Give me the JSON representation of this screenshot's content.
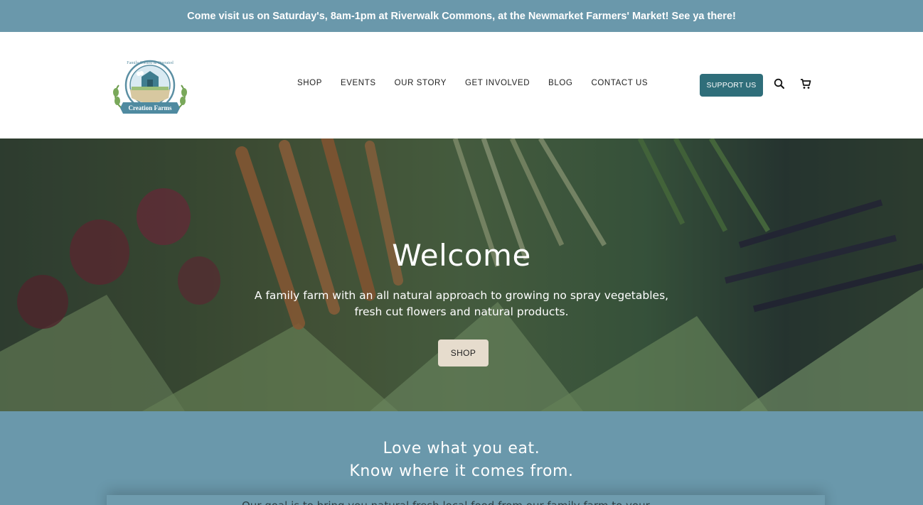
{
  "announcement": {
    "text": "Come visit us on Saturday's, 8am-1pm at Riverwalk Commons, at the Newmarket Farmers' Market! See ya there!"
  },
  "header": {
    "logo": {
      "name": "creation-farms-logo",
      "tagline": "Family Owned & Operated",
      "brand": "Creation Farms"
    },
    "nav": [
      {
        "label": "SHOP"
      },
      {
        "label": "EVENTS"
      },
      {
        "label": "OUR STORY"
      },
      {
        "label": "GET INVOLVED"
      },
      {
        "label": "BLOG"
      },
      {
        "label": "CONTACT US"
      }
    ],
    "support_label": "SUPPORT US",
    "search_icon": "search-icon",
    "cart_icon": "cart-icon"
  },
  "hero": {
    "title": "Welcome",
    "subtitle": "A family farm with an all natural approach to growing no spray vegetables, fresh cut flowers and natural products.",
    "cta_label": "SHOP"
  },
  "band": {
    "line1": "Love what you eat.",
    "line2": "Know where it comes from.",
    "partial_text": "Our goal is to bring you natural fresh local food from our family farm to your table."
  },
  "colors": {
    "announcement_bg": "#6a98ab",
    "support_button": "#2f6e7a",
    "shop_button": "#e6dccd",
    "band_bg": "#6a98ab"
  }
}
